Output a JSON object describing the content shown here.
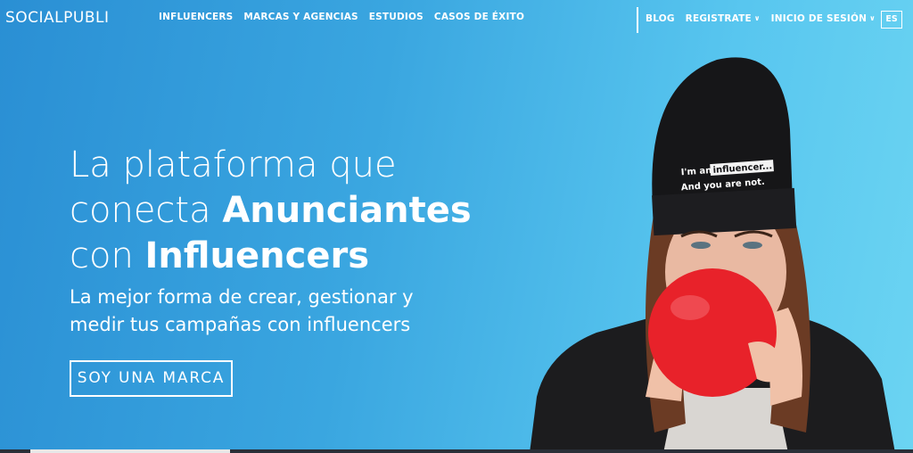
{
  "header": {
    "logo": "SOCIALPUBLI",
    "nav_left": [
      "INFLUENCERS",
      "MARCAS Y AGENCIAS",
      "ESTUDIOS",
      "CASOS DE ÉXITO"
    ],
    "blog": "BLOG",
    "register": "REGISTRATE",
    "login": "INICIO DE SESIÓN",
    "language": "ES"
  },
  "hero": {
    "title_line1": "La plataforma que",
    "title_line2_plain": "conecta ",
    "title_line2_bold": "Anunciantes",
    "title_line3_plain": "con ",
    "title_line3_bold": "Influencers",
    "subtitle": "La mejor forma de crear, gestionar y medir tus campañas con influencers",
    "cta_label": "SOY UNA MARCA"
  },
  "photo": {
    "beanie_line1_prefix": "I'm an ",
    "beanie_line1_highlight": "influencer...",
    "beanie_line2": "And you are not."
  },
  "colors": {
    "gradient_start": "#2a8fd4",
    "gradient_end": "#6bd4f2",
    "text": "#ffffff",
    "balloon": "#e8222a"
  }
}
